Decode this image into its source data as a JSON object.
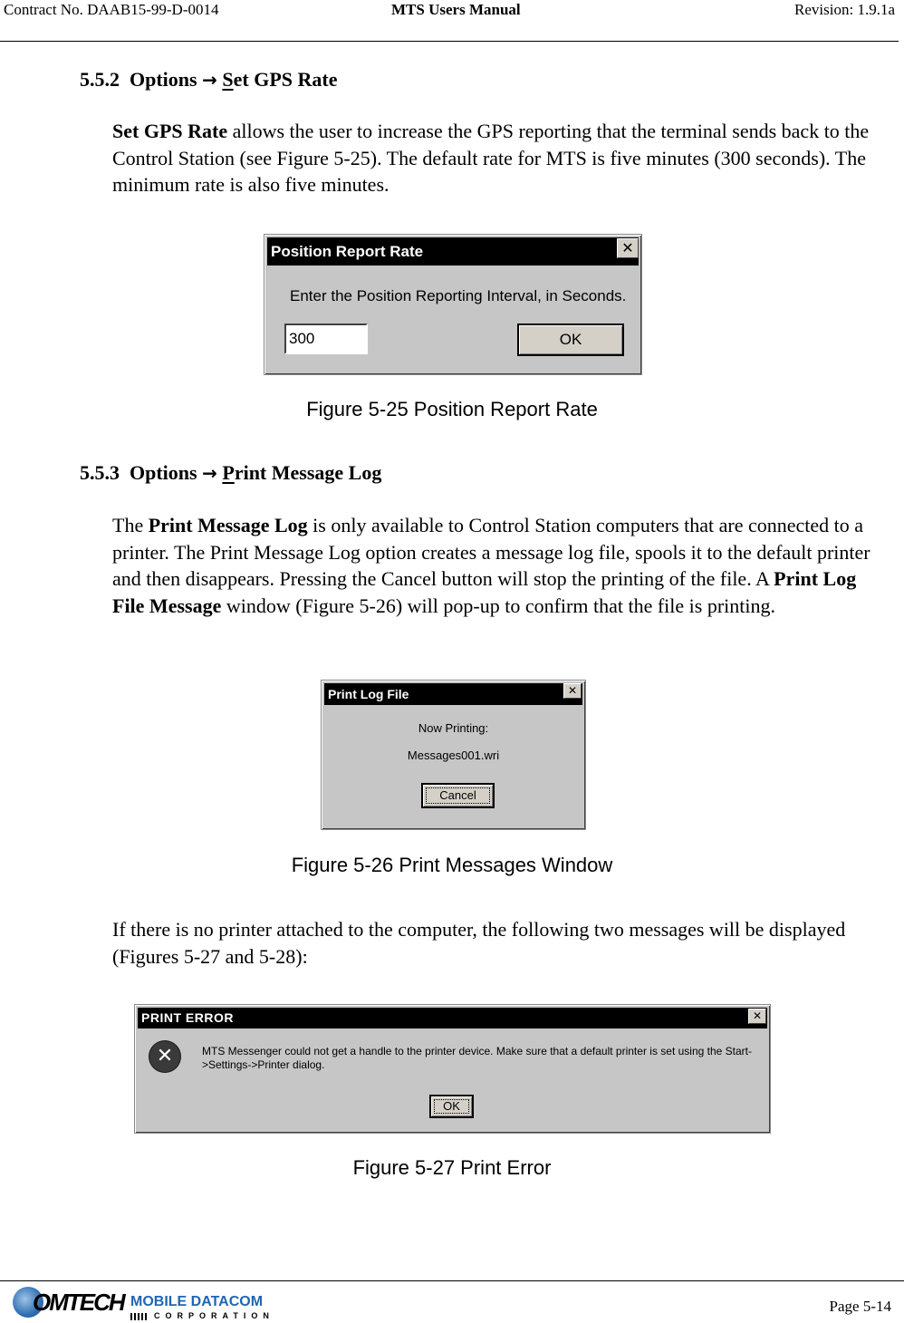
{
  "header": {
    "contract": "Contract No. DAAB15-99-D-0014",
    "title": "MTS Users Manual",
    "revision": "Revision:  1.9.1a"
  },
  "section_552": {
    "number": "5.5.2",
    "menu": "Options",
    "arrow": "→",
    "item_underlined": "S",
    "item_rest": "et GPS Rate",
    "para_bold": "Set GPS Rate",
    "para_text": " allows the user to increase the GPS reporting that the terminal sends back to the Control Station (see Figure 5-25).  The default rate for MTS is five minutes (300 seconds).  The minimum rate is also five minutes."
  },
  "figure_525": {
    "dialog_title": "Position Report Rate",
    "close_glyph": "✕",
    "prompt": "Enter the Position Reporting Interval, in Seconds.",
    "input_value": "300",
    "ok_label": "OK",
    "caption": "Figure 5-25   Position Report Rate"
  },
  "section_553": {
    "number": "5.5.3",
    "menu": "Options",
    "arrow": "→",
    "item_underlined": "P",
    "item_rest": "rint Message Log",
    "para_1": "The ",
    "para_bold_1": "Print Message Log",
    "para_2": " is only available to Control Station computers that are connected to a printer.  The Print Message Log option creates a message log file, spools it to the default printer and then disappears.  Pressing the Cancel button will stop the printing of the file. A ",
    "para_bold_2": "Print Log File Message",
    "para_3": " window (Figure 5-26) will pop-up to confirm that the file is printing."
  },
  "figure_526": {
    "dialog_title": "Print Log File",
    "close_glyph": "✕",
    "line1": "Now Printing:",
    "line2": "Messages001.wri",
    "cancel_label": "Cancel",
    "caption": "Figure 5-26   Print Messages Window"
  },
  "no_printer_para": "If there is no printer attached to the computer, the following two messages will be displayed (Figures 5-27 and 5-28):",
  "figure_527": {
    "dialog_title": "PRINT ERROR",
    "close_glyph": "✕",
    "error_glyph": "✕",
    "message": "MTS Messenger could not get a handle to the printer device.  Make sure that a default printer is set using the Start->Settings->Printer dialog.",
    "ok_label": "OK",
    "caption": "Figure 5-27   Print Error"
  },
  "footer": {
    "logo_comtech": "OMTECH",
    "logo_mobile": "MOBILE DATACOM",
    "logo_corp": "CORPORATION",
    "page": "Page 5-14"
  }
}
